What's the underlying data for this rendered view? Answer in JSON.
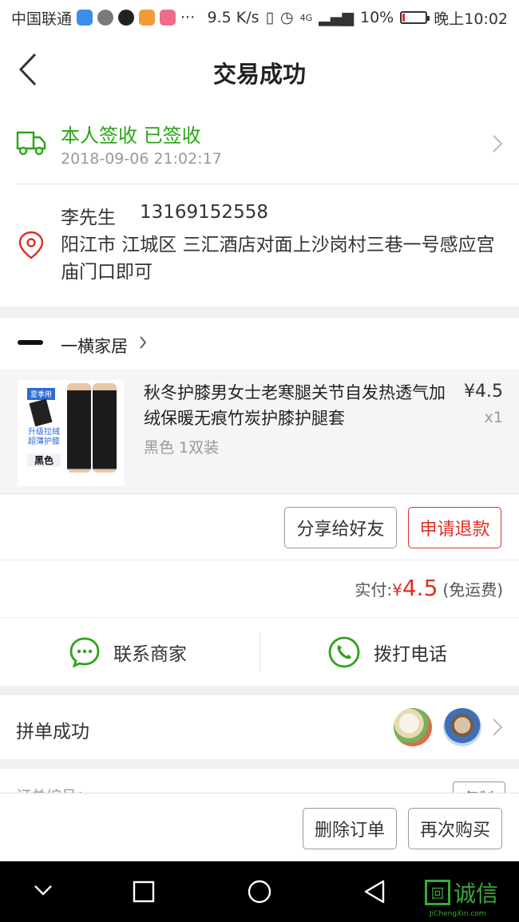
{
  "status_bar": {
    "carrier": "中国联通",
    "speed": "9.5 K/s",
    "signal": "4G",
    "battery": "10%",
    "battery_level": 0.1,
    "time": "晚上10:02",
    "more": "···"
  },
  "header": {
    "title": "交易成功"
  },
  "delivery": {
    "status": "本人签收 已签收",
    "time": "2018-09-06 21:02:17"
  },
  "address": {
    "name": "李先生",
    "phone": "13169152558",
    "text": "阳江市 江城区 三汇酒店对面上沙岗村三巷一号感应宫庙门口即可"
  },
  "shop": {
    "name": "一横家居"
  },
  "product": {
    "title": "秋冬护膝男女士老寒腿关节自发热透气加绒保暖无痕竹炭护膝护腿套",
    "spec": "黑色 1双装",
    "price": "¥4.5",
    "qty": "x1",
    "thumb_tag": "夏季用",
    "thumb_line1": "升级拉绒",
    "thumb_line2": "超薄护膝",
    "thumb_color": "黑色"
  },
  "product_actions": {
    "share": "分享给好友",
    "refund": "申请退款"
  },
  "payment": {
    "label": "实付:",
    "currency": "¥",
    "amount": "4.5",
    "note": "(免运费)"
  },
  "contact": {
    "merchant": "联系商家",
    "call": "拨打电话"
  },
  "group": {
    "label": "拼单成功"
  },
  "order": {
    "number_label": "订单编号：",
    "copy": "复制"
  },
  "bottom_actions": {
    "delete": "删除订单",
    "rebuy": "再次购买"
  },
  "watermark": {
    "text": "诚信",
    "sub": "JiChengXin.com"
  },
  "colors": {
    "accent_red": "#e02e24",
    "success_green": "#2aa515",
    "contact_green": "#2aa515"
  }
}
